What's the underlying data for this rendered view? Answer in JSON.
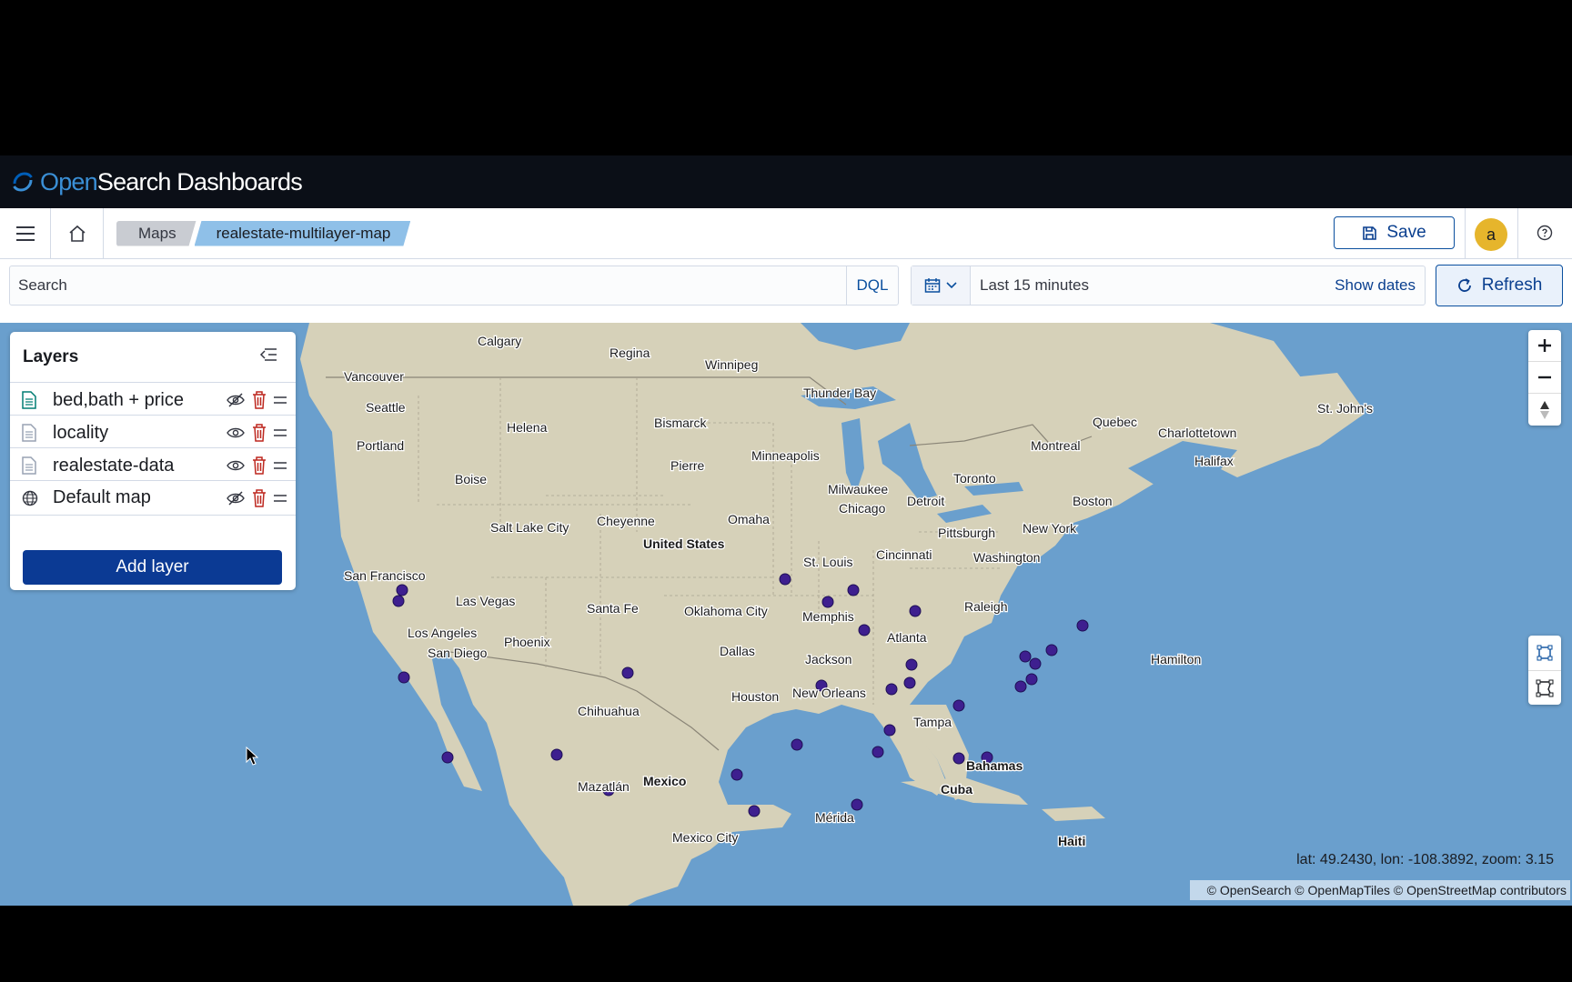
{
  "brand": {
    "prefix": "Open",
    "suffix": "Search Dashboards"
  },
  "nav": {
    "breadcrumbs": [
      "Maps",
      "realestate-multilayer-map"
    ],
    "save_label": "Save",
    "avatar_letter": "a"
  },
  "query": {
    "search_placeholder": "Search",
    "language": "DQL",
    "time_range": "Last 15 minutes",
    "show_dates": "Show dates",
    "refresh": "Refresh"
  },
  "layers": {
    "title": "Layers",
    "items": [
      {
        "name": "bed,bath + price",
        "icon": "document-icon",
        "visible": false
      },
      {
        "name": "locality",
        "icon": "document-icon",
        "visible": true
      },
      {
        "name": "realestate-data",
        "icon": "document-icon",
        "visible": true
      },
      {
        "name": "Default map",
        "icon": "globe-icon",
        "visible": false
      }
    ],
    "add_label": "Add layer"
  },
  "map": {
    "coords": "lat: 49.2430, lon: -108.3892, zoom: 3.15",
    "attribution": "© OpenSearch © OpenMapTiles © OpenStreetMap contributors",
    "labels": [
      "Calgary",
      "Regina",
      "Winnipeg",
      "Vancouver",
      "Seattle",
      "Thunder Bay",
      "Helena",
      "Bismarck",
      "Quebec",
      "Charlottetown",
      "St. John's",
      "Portland",
      "Minneapolis",
      "Pierre",
      "Montreal",
      "Halifax",
      "Boise",
      "Milwaukee",
      "Toronto",
      "Detroit",
      "Boston",
      "Chicago",
      "Salt Lake City",
      "Cheyenne",
      "Omaha",
      "Pittsburgh",
      "New York",
      "United States",
      "Cincinnati",
      "Washington",
      "St. Louis",
      "San Francisco",
      "Las Vegas",
      "Santa Fe",
      "Oklahoma City",
      "Memphis",
      "Raleigh",
      "Los Angeles",
      "Phoenix",
      "Atlanta",
      "San Diego",
      "Dallas",
      "Jackson",
      "Hamilton",
      "Houston",
      "New Orleans",
      "Chihuahua",
      "Tampa",
      "Bahamas",
      "Mazatlán",
      "Mexico",
      "Cuba",
      "Mérida",
      "Mexico City",
      "Haiti"
    ],
    "colors": {
      "water": "#6a9fcd",
      "land": "#d6d1b9",
      "marker": "#3e1f8f"
    }
  }
}
